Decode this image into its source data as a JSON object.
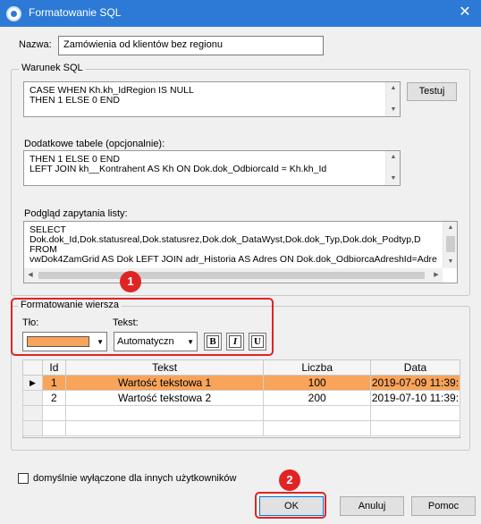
{
  "window": {
    "title": "Formatowanie SQL",
    "close_glyph": "✕"
  },
  "name": {
    "label": "Nazwa:",
    "value": "Zamówienia od klientów bez regionu"
  },
  "sql_condition": {
    "group_title": "Warunek SQL",
    "lines": [
      "CASE WHEN Kh.kh_IdRegion IS NULL",
      "THEN 1 ELSE 0 END"
    ],
    "test_button": "Testuj"
  },
  "extra_tables": {
    "label": "Dodatkowe tabele (opcjonalnie):",
    "lines": [
      "THEN 1 ELSE 0 END",
      "LEFT JOIN kh__Kontrahent AS Kh ON Dok.dok_OdbiorcaId = Kh.kh_Id"
    ]
  },
  "preview": {
    "label": "Podgląd zapytania listy:",
    "lines": [
      "SELECT",
      "Dok.dok_Id,Dok.statusreal,Dok.statusrez,Dok.dok_DataWyst,Dok.dok_Typ,Dok.dok_Podtyp,D",
      "FROM",
      "vwDok4ZamGrid AS Dok LEFT JOIN adr_Historia AS Adres ON Dok.dok_OdbiorcaAdreshId=Adre"
    ]
  },
  "row_format": {
    "group_title": "Formatowanie wiersza",
    "bg_label": "Tło:",
    "bg_color": "#f8a45a",
    "text_label": "Tekst:",
    "text_value": "Automatyczn",
    "bold": "B",
    "italic": "I",
    "underline": "U"
  },
  "grid": {
    "columns": [
      "Id",
      "Tekst",
      "Liczba",
      "Data"
    ],
    "rows": [
      {
        "indicator": "▶",
        "id": "1",
        "text": "Wartość tekstowa 1",
        "number": "100",
        "date": "2019-07-09 11:39:"
      },
      {
        "indicator": "",
        "id": "2",
        "text": "Wartość tekstowa 2",
        "number": "200",
        "date": "2019-07-10 11:39:"
      }
    ]
  },
  "default_off": {
    "label": "domyślnie wyłączone dla innych użytkowników",
    "checked": false
  },
  "buttons": {
    "ok": "OK",
    "cancel": "Anuluj",
    "help": "Pomoc"
  },
  "callouts": {
    "one": "1",
    "two": "2"
  },
  "colors": {
    "titlebar": "#2c7ad6",
    "highlight": "#e02424",
    "selected_row": "#f8a45a"
  }
}
